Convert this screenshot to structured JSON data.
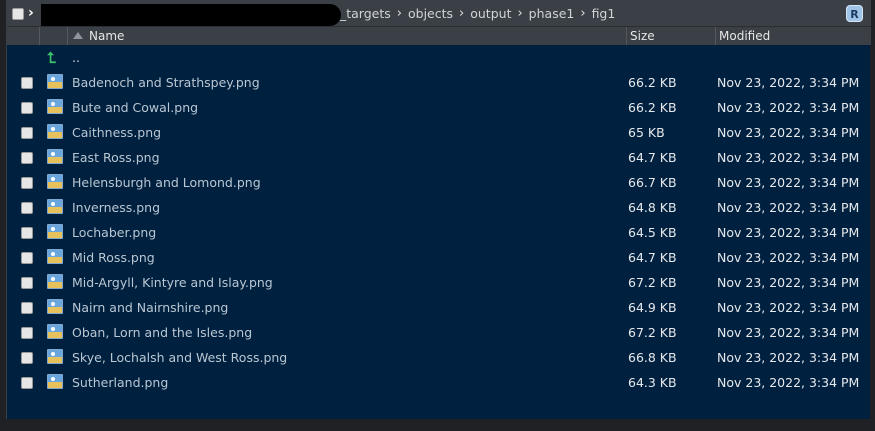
{
  "breadcrumb": {
    "segments": [
      "_targets",
      "objects",
      "output",
      "phase1",
      "fig1"
    ],
    "separator": "›"
  },
  "header": {
    "name_label": "Name",
    "size_label": "Size",
    "modified_label": "Modified"
  },
  "parent_link": "..",
  "r_badge": "R",
  "files": [
    {
      "name": "Badenoch and Strathspey.png",
      "size": "66.2 KB",
      "modified": "Nov 23, 2022, 3:34 PM"
    },
    {
      "name": "Bute and Cowal.png",
      "size": "66.2 KB",
      "modified": "Nov 23, 2022, 3:34 PM"
    },
    {
      "name": "Caithness.png",
      "size": "65 KB",
      "modified": "Nov 23, 2022, 3:34 PM"
    },
    {
      "name": "East Ross.png",
      "size": "64.7 KB",
      "modified": "Nov 23, 2022, 3:34 PM"
    },
    {
      "name": "Helensburgh and Lomond.png",
      "size": "66.7 KB",
      "modified": "Nov 23, 2022, 3:34 PM"
    },
    {
      "name": "Inverness.png",
      "size": "64.8 KB",
      "modified": "Nov 23, 2022, 3:34 PM"
    },
    {
      "name": "Lochaber.png",
      "size": "64.5 KB",
      "modified": "Nov 23, 2022, 3:34 PM"
    },
    {
      "name": "Mid Ross.png",
      "size": "64.7 KB",
      "modified": "Nov 23, 2022, 3:34 PM"
    },
    {
      "name": "Mid-Argyll, Kintyre and Islay.png",
      "size": "67.2 KB",
      "modified": "Nov 23, 2022, 3:34 PM"
    },
    {
      "name": "Nairn and Nairnshire.png",
      "size": "64.9 KB",
      "modified": "Nov 23, 2022, 3:34 PM"
    },
    {
      "name": "Oban, Lorn and the Isles.png",
      "size": "67.2 KB",
      "modified": "Nov 23, 2022, 3:34 PM"
    },
    {
      "name": "Skye, Lochalsh and West Ross.png",
      "size": "66.8 KB",
      "modified": "Nov 23, 2022, 3:34 PM"
    },
    {
      "name": "Sutherland.png",
      "size": "64.3 KB",
      "modified": "Nov 23, 2022, 3:34 PM"
    }
  ],
  "colors": {
    "panel_bg": "#00203f",
    "bar_bg": "#3b4047",
    "file_name_text": "#b9c7d3",
    "up_arrow": "#3cc26d"
  }
}
